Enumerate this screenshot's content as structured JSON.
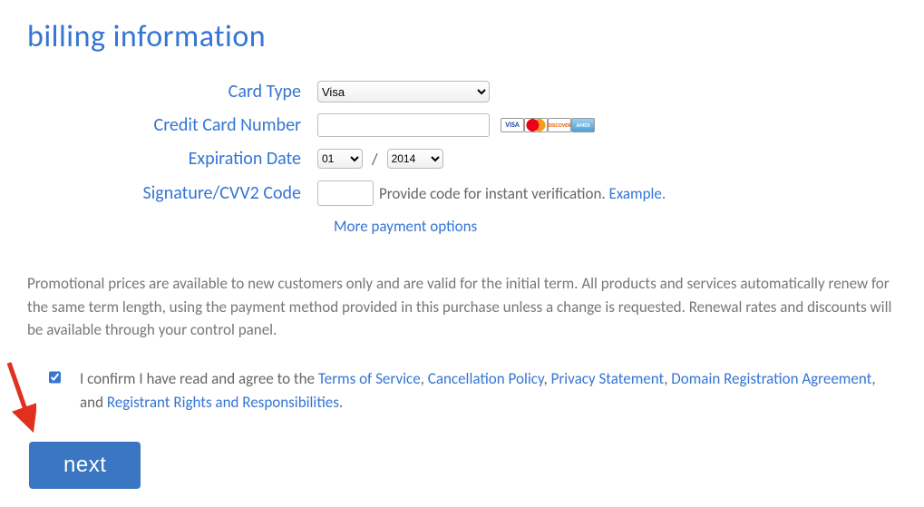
{
  "title": "billing information",
  "form": {
    "card_type": {
      "label": "Card Type",
      "value": "Visa"
    },
    "card_number": {
      "label": "Credit Card Number",
      "value": ""
    },
    "expiration": {
      "label": "Expiration Date",
      "month": "01",
      "year": "2014",
      "slash": "/"
    },
    "cvv": {
      "label": "Signature/CVV2 Code",
      "value": "",
      "hint": "Provide code for instant verification.",
      "example_link": "Example"
    },
    "more_options": "More payment options"
  },
  "card_brands": [
    "VISA",
    "MC",
    "DISCOVER",
    "AMEX"
  ],
  "promo_text": "Promotional prices are available to new customers only and are valid for the initial term. All products and services automatically renew for the same term length, using the payment method provided in this purchase unless a change is requested. Renewal rates and discounts will be available through your control panel.",
  "confirm": {
    "checked": true,
    "prefix": "I confirm I have read and agree to the ",
    "links": [
      "Terms of Service",
      "Cancellation Policy",
      "Privacy Statement",
      "Domain Registration Agreement"
    ],
    "joiner_comma": ", ",
    "and": ", and ",
    "last_link": "Registrant Rights and Responsibilities",
    "period": "."
  },
  "next_button": "next"
}
